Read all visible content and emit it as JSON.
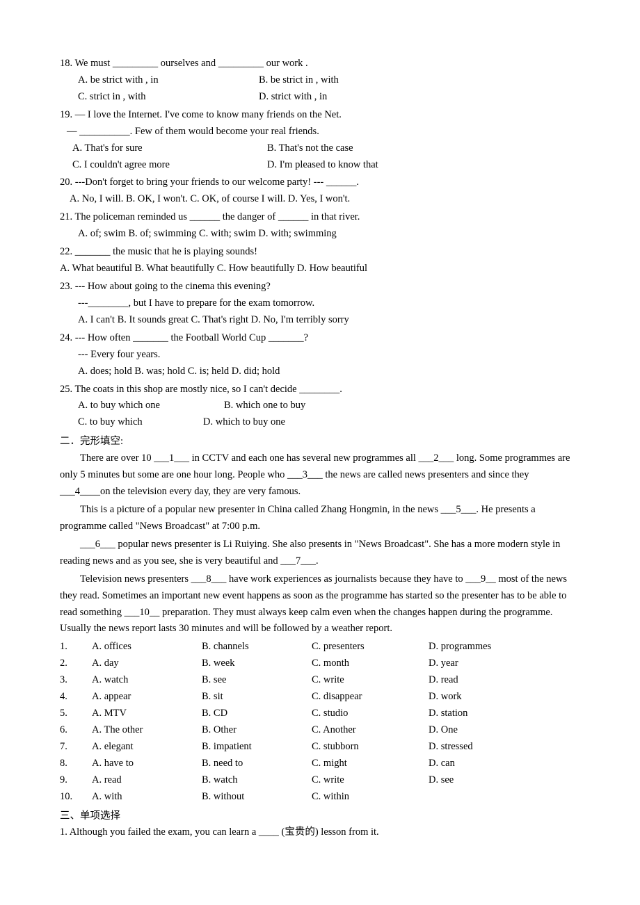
{
  "questions": [
    {
      "num": "18.",
      "text": "We must _________ ourselves and _________ our work .",
      "opts": [
        [
          "A. be strict with , in",
          "B. be strict in , with"
        ],
        [
          "C. strict in , with",
          "D. strict with , in"
        ]
      ]
    },
    {
      "num": "19.",
      "text": "— I love the Internet. I've come to know many friends on the Net.",
      "line2": "— __________. Few of them would become your real friends.",
      "opts": [
        [
          "A. That's for sure",
          "B. That's not the case"
        ],
        [
          "C. I couldn't agree more",
          "D. I'm pleased to know that"
        ]
      ]
    },
    {
      "num": "20.",
      "text": "---Don't forget to bring your friends to our welcome party!  --- ______.",
      "opts_line": "A. No, I will.  B. OK, I won't.  C. OK, of course I will.  D. Yes, I won't."
    },
    {
      "num": "21.",
      "text": "The policeman reminded us ______ the danger of ______ in that river.",
      "opts_line": "A. of; swim   B. of; swimming   C. with; swim  D. with; swimming"
    },
    {
      "num": "22.",
      "text": "_______ the music that he is playing sounds!",
      "opts_line": "A. What beautiful B. What beautifully C. How beautifully D. How beautiful"
    },
    {
      "num": "23.",
      "text": "--- How about going to the cinema this evening?",
      "line2": "---________, but I have to prepare for the exam tomorrow.",
      "opts_line": "A. I can't  B. It sounds great  C. That's right  D. No, I'm terribly sorry"
    },
    {
      "num": "24.",
      "text": "--- How often _______ the Football World Cup _______?",
      "line2": "--- Every four years.",
      "opts_line": "A. does; hold      B. was; hold      C. is; held       D. did; hold"
    },
    {
      "num": "25.",
      "text": "The coats in this shop are mostly nice, so I can't decide ________.",
      "opts": [
        [
          "A. to buy which one",
          "B. which one to buy"
        ],
        [
          "C. to buy which",
          "D. which to buy one"
        ]
      ]
    }
  ],
  "section2_title": "二．完形填空:",
  "passage": {
    "p1": "There are over 10 ___1___ in CCTV and each one has several new programmes all ___2___ long. Some programmes are only 5 minutes but some are one hour long. People who ___3___  the news are called news presenters and since they ___4____on the television every day, they are very famous.",
    "p2": "This is a picture of a popular new presenter in China called Zhang Hongmin, in the news ___5___. He presents a programme called \"News Broadcast\" at 7:00 p.m.",
    "p3": "___6___ popular news presenter is Li Ruiying. She also presents in \"News Broadcast\". She has a more modern style in reading news and as you see, she is very beautiful and ___7___.",
    "p4": "Television news presenters ___8___ have work experiences as journalists because they have to ___9__ most of the news they read. Sometimes an important new event happens as soon as the programme has started so the presenter has to be able to read something ___10__ preparation. They must always keep calm even when the changes happen during the programme. Usually the news report lasts 30 minutes and will be followed by a weather report."
  },
  "cloze_opts": [
    [
      "1.",
      "A. offices",
      "B. channels",
      "C. presenters",
      "D. programmes"
    ],
    [
      "2.",
      "A. day",
      "B. week",
      "C. month",
      "D. year"
    ],
    [
      "3.",
      "A. watch",
      "B. see",
      "C. write",
      "D. read"
    ],
    [
      "4.",
      "A. appear",
      "B. sit",
      "C. disappear",
      "D. work"
    ],
    [
      "5.",
      "A. MTV",
      "B. CD",
      "C. studio",
      "D. station"
    ],
    [
      "6.",
      "A. The other",
      "B. Other",
      "C. Another",
      "D. One"
    ],
    [
      "7.",
      "A. elegant",
      "B. impatient",
      "C. stubborn",
      "D. stressed"
    ],
    [
      "8.",
      "A. have to",
      "B. need to",
      "C. might",
      "D. can"
    ],
    [
      "9.",
      "A. read",
      "B. watch",
      "C. write",
      "D. see"
    ],
    [
      "10.",
      "A. with",
      "B. without",
      "C. within",
      ""
    ]
  ],
  "section3_title": "三、单项选择",
  "fill_q1": "1. Although you failed the exam, you can learn a ____ (宝贵的) lesson from it."
}
